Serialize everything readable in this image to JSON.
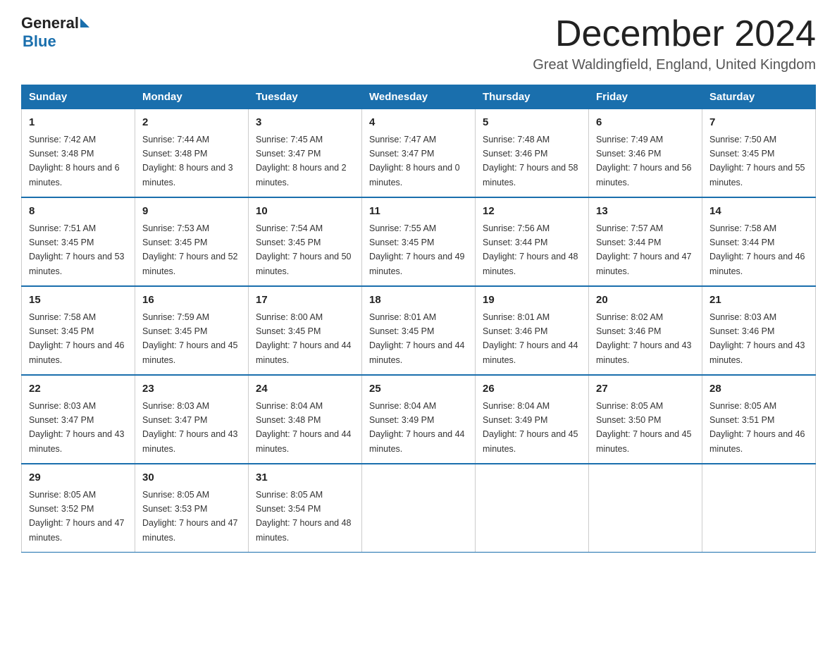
{
  "header": {
    "logo_general": "General",
    "logo_blue": "Blue",
    "month_title": "December 2024",
    "location": "Great Waldingfield, England, United Kingdom"
  },
  "days_of_week": [
    "Sunday",
    "Monday",
    "Tuesday",
    "Wednesday",
    "Thursday",
    "Friday",
    "Saturday"
  ],
  "weeks": [
    [
      {
        "day": "1",
        "sunrise": "7:42 AM",
        "sunset": "3:48 PM",
        "daylight": "8 hours and 6 minutes."
      },
      {
        "day": "2",
        "sunrise": "7:44 AM",
        "sunset": "3:48 PM",
        "daylight": "8 hours and 3 minutes."
      },
      {
        "day": "3",
        "sunrise": "7:45 AM",
        "sunset": "3:47 PM",
        "daylight": "8 hours and 2 minutes."
      },
      {
        "day": "4",
        "sunrise": "7:47 AM",
        "sunset": "3:47 PM",
        "daylight": "8 hours and 0 minutes."
      },
      {
        "day": "5",
        "sunrise": "7:48 AM",
        "sunset": "3:46 PM",
        "daylight": "7 hours and 58 minutes."
      },
      {
        "day": "6",
        "sunrise": "7:49 AM",
        "sunset": "3:46 PM",
        "daylight": "7 hours and 56 minutes."
      },
      {
        "day": "7",
        "sunrise": "7:50 AM",
        "sunset": "3:45 PM",
        "daylight": "7 hours and 55 minutes."
      }
    ],
    [
      {
        "day": "8",
        "sunrise": "7:51 AM",
        "sunset": "3:45 PM",
        "daylight": "7 hours and 53 minutes."
      },
      {
        "day": "9",
        "sunrise": "7:53 AM",
        "sunset": "3:45 PM",
        "daylight": "7 hours and 52 minutes."
      },
      {
        "day": "10",
        "sunrise": "7:54 AM",
        "sunset": "3:45 PM",
        "daylight": "7 hours and 50 minutes."
      },
      {
        "day": "11",
        "sunrise": "7:55 AM",
        "sunset": "3:45 PM",
        "daylight": "7 hours and 49 minutes."
      },
      {
        "day": "12",
        "sunrise": "7:56 AM",
        "sunset": "3:44 PM",
        "daylight": "7 hours and 48 minutes."
      },
      {
        "day": "13",
        "sunrise": "7:57 AM",
        "sunset": "3:44 PM",
        "daylight": "7 hours and 47 minutes."
      },
      {
        "day": "14",
        "sunrise": "7:58 AM",
        "sunset": "3:44 PM",
        "daylight": "7 hours and 46 minutes."
      }
    ],
    [
      {
        "day": "15",
        "sunrise": "7:58 AM",
        "sunset": "3:45 PM",
        "daylight": "7 hours and 46 minutes."
      },
      {
        "day": "16",
        "sunrise": "7:59 AM",
        "sunset": "3:45 PM",
        "daylight": "7 hours and 45 minutes."
      },
      {
        "day": "17",
        "sunrise": "8:00 AM",
        "sunset": "3:45 PM",
        "daylight": "7 hours and 44 minutes."
      },
      {
        "day": "18",
        "sunrise": "8:01 AM",
        "sunset": "3:45 PM",
        "daylight": "7 hours and 44 minutes."
      },
      {
        "day": "19",
        "sunrise": "8:01 AM",
        "sunset": "3:46 PM",
        "daylight": "7 hours and 44 minutes."
      },
      {
        "day": "20",
        "sunrise": "8:02 AM",
        "sunset": "3:46 PM",
        "daylight": "7 hours and 43 minutes."
      },
      {
        "day": "21",
        "sunrise": "8:03 AM",
        "sunset": "3:46 PM",
        "daylight": "7 hours and 43 minutes."
      }
    ],
    [
      {
        "day": "22",
        "sunrise": "8:03 AM",
        "sunset": "3:47 PM",
        "daylight": "7 hours and 43 minutes."
      },
      {
        "day": "23",
        "sunrise": "8:03 AM",
        "sunset": "3:47 PM",
        "daylight": "7 hours and 43 minutes."
      },
      {
        "day": "24",
        "sunrise": "8:04 AM",
        "sunset": "3:48 PM",
        "daylight": "7 hours and 44 minutes."
      },
      {
        "day": "25",
        "sunrise": "8:04 AM",
        "sunset": "3:49 PM",
        "daylight": "7 hours and 44 minutes."
      },
      {
        "day": "26",
        "sunrise": "8:04 AM",
        "sunset": "3:49 PM",
        "daylight": "7 hours and 45 minutes."
      },
      {
        "day": "27",
        "sunrise": "8:05 AM",
        "sunset": "3:50 PM",
        "daylight": "7 hours and 45 minutes."
      },
      {
        "day": "28",
        "sunrise": "8:05 AM",
        "sunset": "3:51 PM",
        "daylight": "7 hours and 46 minutes."
      }
    ],
    [
      {
        "day": "29",
        "sunrise": "8:05 AM",
        "sunset": "3:52 PM",
        "daylight": "7 hours and 47 minutes."
      },
      {
        "day": "30",
        "sunrise": "8:05 AM",
        "sunset": "3:53 PM",
        "daylight": "7 hours and 47 minutes."
      },
      {
        "day": "31",
        "sunrise": "8:05 AM",
        "sunset": "3:54 PM",
        "daylight": "7 hours and 48 minutes."
      },
      null,
      null,
      null,
      null
    ]
  ]
}
